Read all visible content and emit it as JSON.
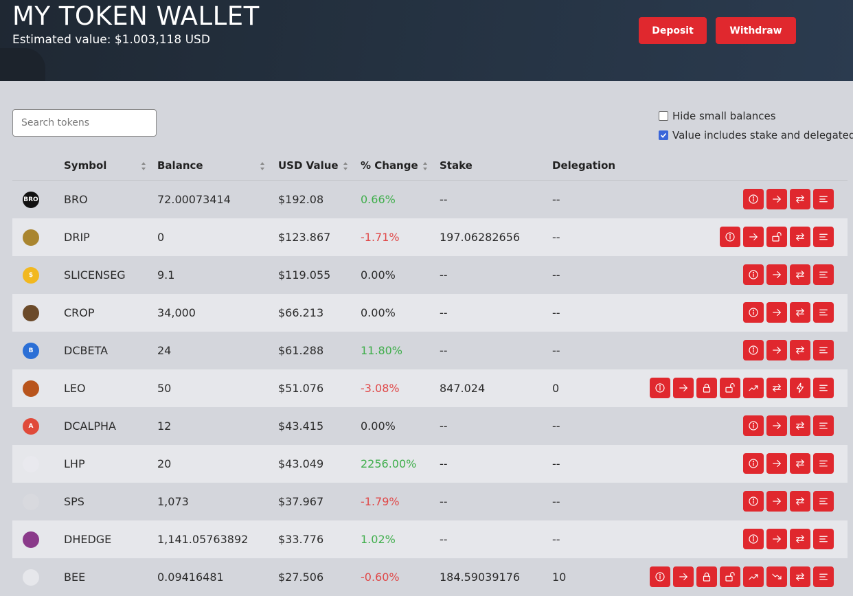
{
  "header": {
    "title": "MY TOKEN WALLET",
    "estimated_value": "Estimated value: $1.003,118 USD",
    "deposit_label": "Deposit",
    "withdraw_label": "Withdraw"
  },
  "search": {
    "placeholder": "Search tokens",
    "value": ""
  },
  "options": {
    "hide_small_label": "Hide small balances",
    "hide_small_checked": false,
    "include_stake_label": "Value includes stake and delegated",
    "include_stake_checked": true
  },
  "columns": {
    "symbol": "Symbol",
    "balance": "Balance",
    "usd_value": "USD Value",
    "change": "% Change",
    "stake": "Stake",
    "delegation": "Delegation"
  },
  "colors": {
    "accent": "#e0282e",
    "positive": "#3fae4b",
    "negative": "#e04747",
    "checkbox": "#3a66d9"
  },
  "rows": [
    {
      "symbol": "BRO",
      "balance": "72.00073414",
      "usd": "$192.08",
      "change": "0.66%",
      "trend": "pos",
      "stake": "--",
      "delegation": "--",
      "actions": [
        "info-icon",
        "transfer-icon",
        "swap-icon",
        "history-icon"
      ],
      "icon_color": "#111111",
      "icon_text": "BRO"
    },
    {
      "symbol": "DRIP",
      "balance": "0",
      "usd": "$123.867",
      "change": "-1.71%",
      "trend": "neg",
      "stake": "197.06282656",
      "delegation": "--",
      "actions": [
        "info-icon",
        "transfer-icon",
        "unlock-icon",
        "swap-icon",
        "history-icon"
      ],
      "icon_color": "#a9852f",
      "icon_text": ""
    },
    {
      "symbol": "SLICENSEG",
      "balance": "9.1",
      "usd": "$119.055",
      "change": "0.00%",
      "trend": "neu",
      "stake": "--",
      "delegation": "--",
      "actions": [
        "info-icon",
        "transfer-icon",
        "swap-icon",
        "history-icon"
      ],
      "icon_color": "#f2b81f",
      "icon_text": "$"
    },
    {
      "symbol": "CROP",
      "balance": "34,000",
      "usd": "$66.213",
      "change": "0.00%",
      "trend": "neu",
      "stake": "--",
      "delegation": "--",
      "actions": [
        "info-icon",
        "transfer-icon",
        "swap-icon",
        "history-icon"
      ],
      "icon_color": "#6b4a2a",
      "icon_text": ""
    },
    {
      "symbol": "DCBETA",
      "balance": "24",
      "usd": "$61.288",
      "change": "11.80%",
      "trend": "pos",
      "stake": "--",
      "delegation": "--",
      "actions": [
        "info-icon",
        "transfer-icon",
        "swap-icon",
        "history-icon"
      ],
      "icon_color": "#2b6fd6",
      "icon_text": "B"
    },
    {
      "symbol": "LEO",
      "balance": "50",
      "usd": "$51.076",
      "change": "-3.08%",
      "trend": "neg",
      "stake": "847.024",
      "delegation": "0",
      "actions": [
        "info-icon",
        "transfer-icon",
        "lock-icon",
        "unlock-icon",
        "trend-up-icon",
        "swap-icon",
        "bolt-icon",
        "history-icon"
      ],
      "icon_color": "#b8541c",
      "icon_text": ""
    },
    {
      "symbol": "DCALPHA",
      "balance": "12",
      "usd": "$43.415",
      "change": "0.00%",
      "trend": "neu",
      "stake": "--",
      "delegation": "--",
      "actions": [
        "info-icon",
        "transfer-icon",
        "swap-icon",
        "history-icon"
      ],
      "icon_color": "#e04a3a",
      "icon_text": "A"
    },
    {
      "symbol": "LHP",
      "balance": "20",
      "usd": "$43.049",
      "change": "2256.00%",
      "trend": "pos",
      "stake": "--",
      "delegation": "--",
      "actions": [
        "info-icon",
        "transfer-icon",
        "swap-icon",
        "history-icon"
      ],
      "icon_color": "#e9e9ee",
      "icon_text": ""
    },
    {
      "symbol": "SPS",
      "balance": "1,073",
      "usd": "$37.967",
      "change": "-1.79%",
      "trend": "neg",
      "stake": "--",
      "delegation": "--",
      "actions": [
        "info-icon",
        "transfer-icon",
        "swap-icon",
        "history-icon"
      ],
      "icon_color": "#d8d9de",
      "icon_text": ""
    },
    {
      "symbol": "DHEDGE",
      "balance": "1,141.05763892",
      "usd": "$33.776",
      "change": "1.02%",
      "trend": "pos",
      "stake": "--",
      "delegation": "--",
      "actions": [
        "info-icon",
        "transfer-icon",
        "swap-icon",
        "history-icon"
      ],
      "icon_color": "#8a3a8a",
      "icon_text": ""
    },
    {
      "symbol": "BEE",
      "balance": "0.09416481",
      "usd": "$27.506",
      "change": "-0.60%",
      "trend": "neg",
      "stake": "184.59039176",
      "delegation": "10",
      "actions": [
        "info-icon",
        "transfer-icon",
        "lock-icon",
        "unlock-icon",
        "trend-up-icon",
        "trend-down-icon",
        "swap-icon",
        "history-icon"
      ],
      "icon_color": "#e6e7eb",
      "icon_text": ""
    }
  ]
}
